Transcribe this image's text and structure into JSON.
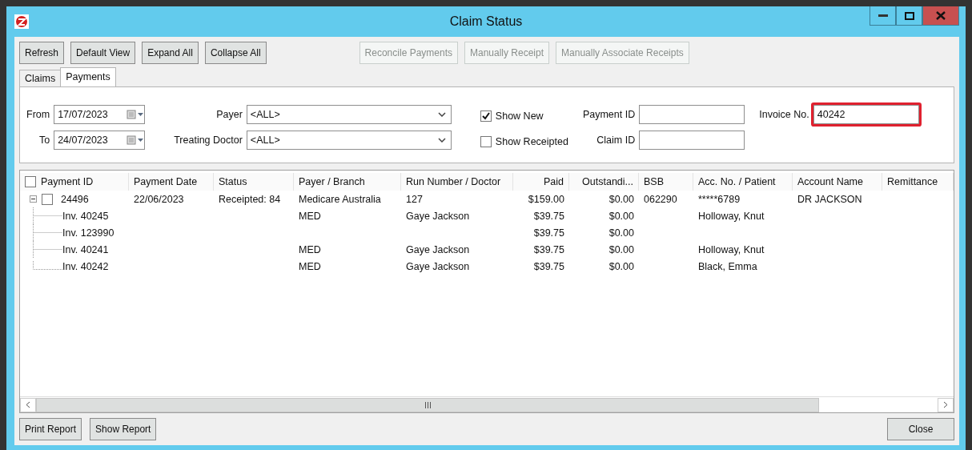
{
  "window": {
    "title": "Claim Status"
  },
  "toolbar": [
    {
      "label": "Refresh",
      "disabled": false
    },
    {
      "label": "Default View",
      "disabled": false
    },
    {
      "label": "Expand All",
      "disabled": false
    },
    {
      "label": "Collapse All",
      "disabled": false
    },
    {
      "label": "Reconcile Payments",
      "disabled": true
    },
    {
      "label": "Manually Receipt",
      "disabled": true
    },
    {
      "label": "Manually Associate Receipts",
      "disabled": true
    }
  ],
  "tabs": [
    {
      "label": "Claims",
      "selected": false
    },
    {
      "label": "Payments",
      "selected": true
    }
  ],
  "filters": {
    "from": {
      "label": "From",
      "value": "17/07/2023"
    },
    "to": {
      "label": "To",
      "value": "24/07/2023"
    },
    "payer": {
      "label": "Payer",
      "value": "<ALL>"
    },
    "doctor": {
      "label": "Treating Doctor",
      "value": "<ALL>"
    },
    "show_new": {
      "label": "Show New",
      "checked": true
    },
    "show_receipted": {
      "label": "Show Receipted",
      "checked": false
    },
    "payment_id": {
      "label": "Payment ID"
    },
    "claim_id": {
      "label": "Claim ID"
    },
    "invoice_no": {
      "label": "Invoice No.",
      "value": "40242",
      "highlighted": true
    }
  },
  "grid": {
    "select_all_checked": false,
    "columns": [
      "Payment ID",
      "Payment Date",
      "Status",
      "Payer / Branch",
      "Run Number / Doctor",
      "Paid",
      "Outstandi...",
      "BSB",
      "Acc. No. / Patient",
      "Account Name",
      "Remittance"
    ],
    "rows": [
      {
        "cells": [
          "24496",
          "22/06/2023",
          "Receipted: 84",
          "Medicare Australia",
          "127",
          "$159.00",
          "$0.00",
          "062290",
          "*****6789",
          "DR JACKSON",
          ""
        ],
        "checked": false,
        "expanded": true,
        "children": [
          {
            "cells": [
              "Inv. 40245",
              "",
              "",
              "MED",
              "Gaye Jackson",
              "$39.75",
              "$0.00",
              "",
              "Holloway, Knut",
              "",
              ""
            ]
          },
          {
            "cells": [
              "Inv. 123990",
              "",
              "",
              "",
              "",
              "$39.75",
              "$0.00",
              "",
              "",
              "",
              ""
            ]
          },
          {
            "cells": [
              "Inv. 40241",
              "",
              "",
              "MED",
              "Gaye Jackson",
              "$39.75",
              "$0.00",
              "",
              "Holloway, Knut",
              "",
              ""
            ]
          },
          {
            "cells": [
              "Inv. 40242",
              "",
              "",
              "MED",
              "Gaye Jackson",
              "$39.75",
              "$0.00",
              "",
              "Black, Emma",
              "",
              ""
            ]
          }
        ]
      }
    ]
  },
  "footer": {
    "left": [
      "Print Report",
      "Show Report"
    ],
    "right": [
      "Close"
    ]
  }
}
